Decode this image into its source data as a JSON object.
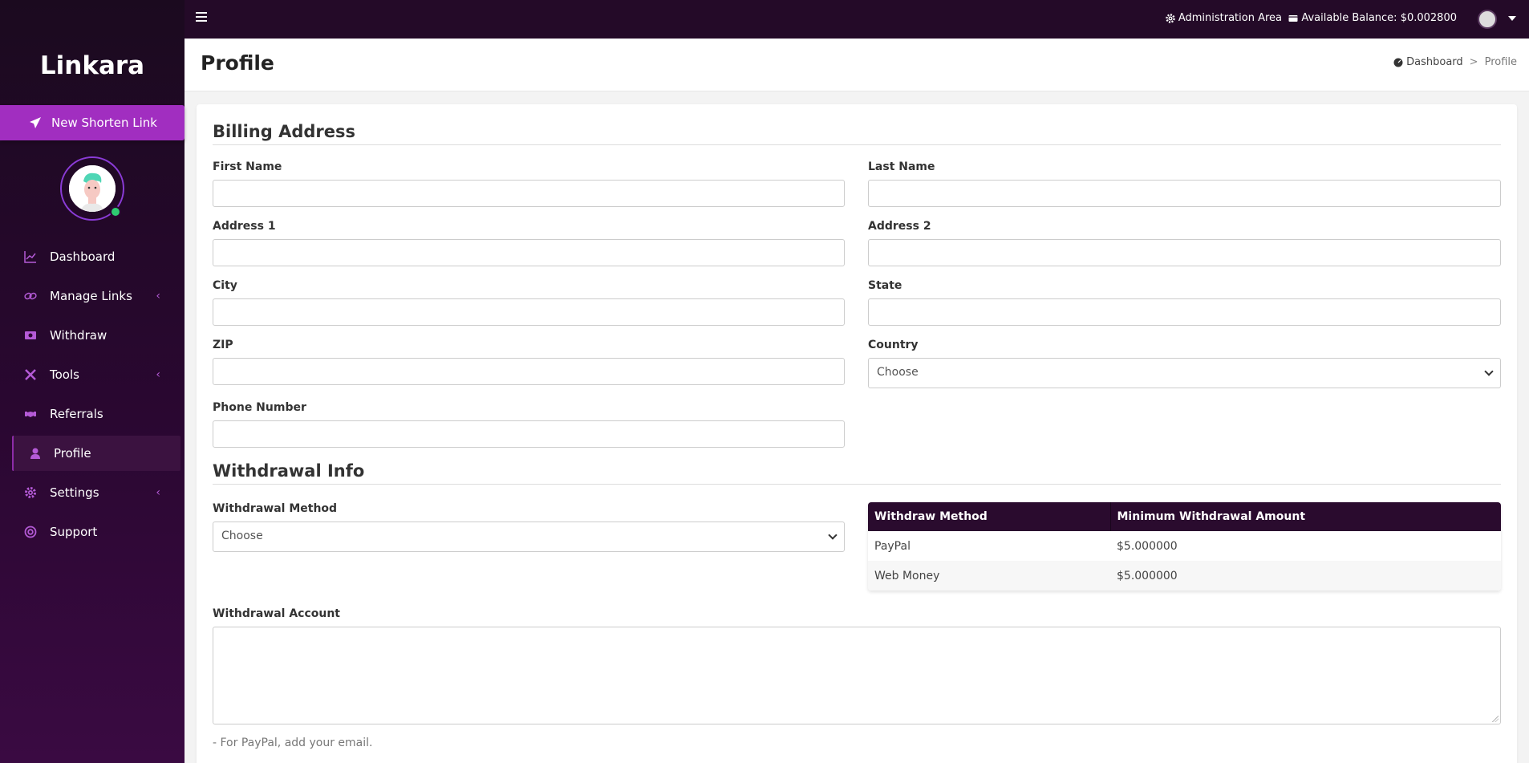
{
  "brand": "Linkara",
  "new_link_label": "New Shorten Link",
  "nav": [
    {
      "label": "Dashboard",
      "icon": "chart-line-icon",
      "submenu": false
    },
    {
      "label": "Manage Links",
      "icon": "link-icon",
      "submenu": true
    },
    {
      "label": "Withdraw",
      "icon": "money-icon",
      "submenu": false
    },
    {
      "label": "Tools",
      "icon": "tools-icon",
      "submenu": true
    },
    {
      "label": "Referrals",
      "icon": "handshake-icon",
      "submenu": false
    },
    {
      "label": "Profile",
      "icon": "user-icon",
      "submenu": false,
      "active": true
    },
    {
      "label": "Settings",
      "icon": "gear-icon",
      "submenu": true
    },
    {
      "label": "Support",
      "icon": "lifebuoy-icon",
      "submenu": false
    }
  ],
  "topbar": {
    "admin_area": "Administration Area",
    "balance": "Available Balance: $0.002800"
  },
  "header": {
    "title": "Profile",
    "breadcrumb": {
      "home": "Dashboard",
      "separator": ">",
      "current": "Profile"
    }
  },
  "billing": {
    "title": "Billing Address",
    "first_name": "First Name",
    "last_name": "Last Name",
    "address1": "Address 1",
    "address2": "Address 2",
    "city": "City",
    "state": "State",
    "zip": "ZIP",
    "country": "Country",
    "country_value": "Choose",
    "phone": "Phone Number"
  },
  "withdrawal": {
    "title": "Withdrawal Info",
    "method_label": "Withdrawal Method",
    "method_value": "Choose",
    "table_headers": [
      "Withdraw Method",
      "Minimum Withdrawal Amount"
    ],
    "table_rows": [
      [
        "PayPal",
        "$5.000000"
      ],
      [
        "Web Money",
        "$5.000000"
      ]
    ],
    "account_label": "Withdrawal Account",
    "hint": "- For PayPal, add your email."
  },
  "colors": {
    "accent": "#a12ec0",
    "sidebar_bg": "#2a0731",
    "topbar_bg": "#240a28",
    "online": "#2ecc71"
  }
}
